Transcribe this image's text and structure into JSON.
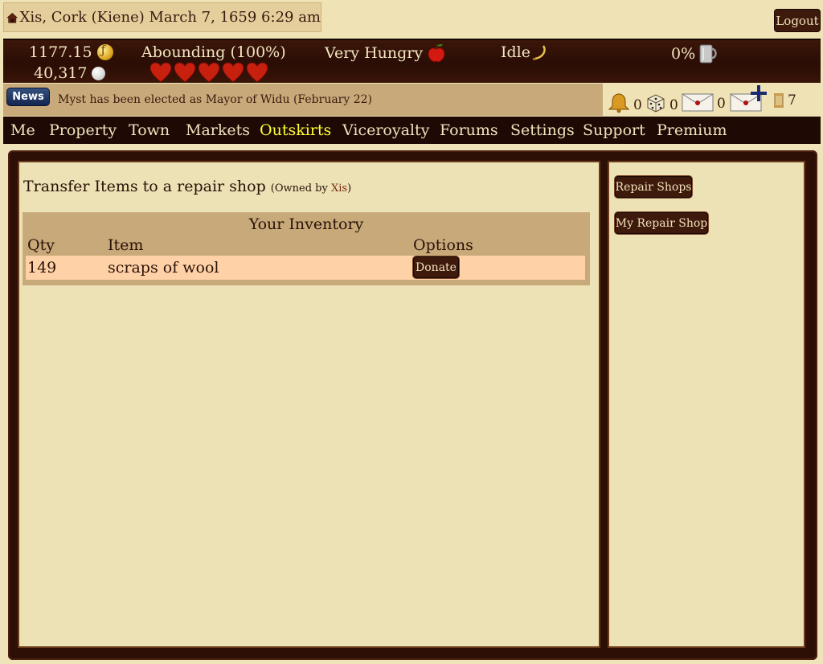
{
  "header": {
    "location": "Xis, Cork (Kiene)",
    "datetime": "March 7, 1659 6:29 am",
    "logout_label": "Logout"
  },
  "status": {
    "gold": "1177.15",
    "silver": "40,317",
    "health": "Abounding (100%)",
    "hearts": 5,
    "hunger": "Very Hungry",
    "activity": "Idle",
    "drink": "0%"
  },
  "news": {
    "button_label": "News",
    "text": "Myst has been elected as Mayor of Widu (February 22)"
  },
  "notifications": {
    "bell_count": "0",
    "dice_count": "0",
    "mail_count": "0",
    "new_mail_count": "0",
    "scroll_count": "7"
  },
  "nav": {
    "items": [
      "Me",
      "Property",
      "Town",
      "Markets",
      "Outskirts",
      "Viceroyalty",
      "Forums",
      "Settings",
      "Support",
      "Premium"
    ],
    "active": "Outskirts"
  },
  "main": {
    "title": "Transfer Items to a repair shop",
    "owned_prefix": "(Owned by",
    "owner": "Xis",
    "owned_suffix": ")"
  },
  "inventory": {
    "heading": "Your Inventory",
    "columns": [
      "Qty",
      "Item",
      "Options"
    ],
    "rows": [
      {
        "qty": "149",
        "item": "scraps of wool",
        "action": "Donate"
      }
    ]
  },
  "sidebar": {
    "buttons": [
      "Repair Shops",
      "My Repair Shop"
    ]
  },
  "colors": {
    "nav_bg": "#1e0904",
    "nav_active": "#ffff33",
    "row_highlight": "#ffd1a7",
    "button_bg": "#3e1a0d"
  }
}
